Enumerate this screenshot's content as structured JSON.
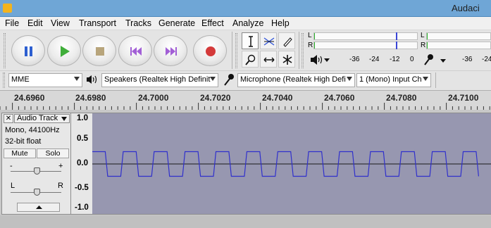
{
  "window": {
    "title": "Audaci"
  },
  "menu": [
    "File",
    "Edit",
    "View",
    "Transport",
    "Tracks",
    "Generate",
    "Effect",
    "Analyze",
    "Help"
  ],
  "meters": {
    "record_channels": [
      "L",
      "R"
    ],
    "play_channels": [
      "L",
      "R"
    ],
    "record_ticks": [
      "-36",
      "-24",
      "-12",
      "0"
    ],
    "play_ticks": [
      "-36",
      "-24"
    ]
  },
  "devices": {
    "host": "MME",
    "output": "Speakers (Realtek High Definit",
    "input": "Microphone (Realtek High Defi",
    "channels": "1 (Mono) Input Ch"
  },
  "timeline": {
    "ticks": [
      "24.6960",
      "24.6980",
      "24.7000",
      "24.7020",
      "24.7040",
      "24.7060",
      "24.7080",
      "24.7100"
    ]
  },
  "track": {
    "name": "Audio Track",
    "close_glyph": "✕",
    "info_rate": "Mono, 44100Hz",
    "info_format": "32-bit float",
    "mute_label": "Mute",
    "solo_label": "Solo",
    "gain_minus": "-",
    "gain_plus": "+",
    "pan_left": "L",
    "pan_right": "R"
  },
  "amplitude_ruler": [
    "1.0",
    "0.5",
    "0.0",
    "-0.5",
    "-1.0"
  ],
  "waveform": {
    "color": "#3030cc",
    "amplitude": 0.25,
    "cycles": 12
  }
}
